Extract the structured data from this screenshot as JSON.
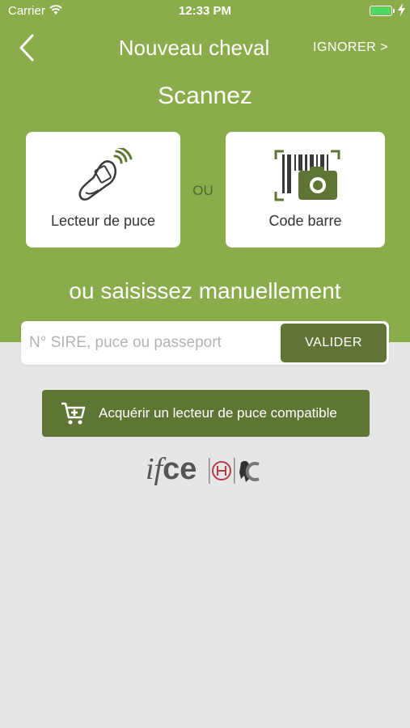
{
  "status_bar": {
    "carrier": "Carrier",
    "time": "12:33 PM",
    "battery_color": "#4cd964"
  },
  "nav": {
    "title": "Nouveau cheval",
    "skip_label": "IGNORER >",
    "back_icon": "chevron-left-icon"
  },
  "scan": {
    "title": "Scannez",
    "separator": "OU",
    "options": [
      {
        "label": "Lecteur de puce",
        "icon": "chip-reader-icon"
      },
      {
        "label": "Code barre",
        "icon": "barcode-camera-icon"
      }
    ]
  },
  "manual": {
    "title": "ou saisissez manuellement",
    "input_placeholder": "N° SIRE, puce ou passeport",
    "input_value": "",
    "validate_label": "VALIDER"
  },
  "buy_button": {
    "label": "Acquérir un lecteur de puce compatible",
    "icon": "cart-icon"
  },
  "logo": {
    "text_i": "if",
    "text_ce": "ce"
  },
  "colors": {
    "header_bg": "#8aac4a",
    "button_dark": "#607535",
    "page_bg": "#e6e6e6"
  }
}
